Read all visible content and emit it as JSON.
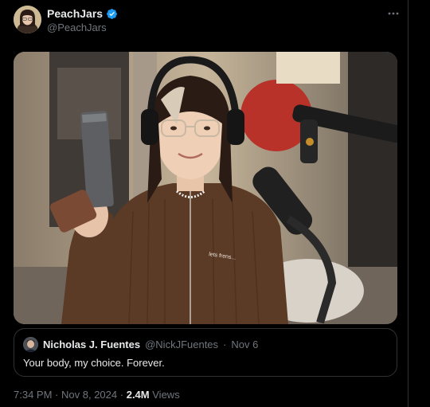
{
  "author": {
    "display_name": "PeachJars",
    "handle": "@PeachJars",
    "verified": true
  },
  "more_icon": "more-horizontal-icon",
  "media": {
    "caption_on_shirt": "lets frens..."
  },
  "quoted_post": {
    "display_name": "Nicholas J. Fuentes",
    "handle": "@NickJFuentes",
    "separator": "·",
    "date": "Nov 6",
    "text": "Your body, my choice. Forever."
  },
  "meta": {
    "time": "7:34 PM",
    "separator1": "·",
    "date": "Nov 8, 2024",
    "separator2": "·",
    "views_count": "2.4M",
    "views_label": "Views"
  },
  "colors": {
    "background": "#000000",
    "text_primary": "#e7e9ea",
    "text_secondary": "#71767b",
    "border": "#2f3336",
    "verified": "#1d9bf0"
  }
}
